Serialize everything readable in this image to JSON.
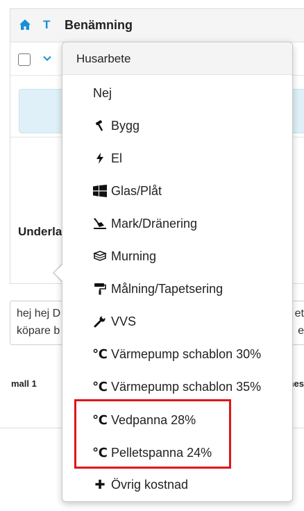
{
  "table": {
    "type_col": "T",
    "name_col": "Benämning",
    "section_label": "Underla"
  },
  "note": {
    "line1": "hej hej D",
    "line2": "köpare b",
    "line1_right": "et",
    "line2_right": "e"
  },
  "footer": {
    "left_label": "mall 1",
    "right_label": "nes"
  },
  "menu": {
    "header": "Husarbete",
    "items": [
      {
        "label": "Nej",
        "icon": "none"
      },
      {
        "label": "Bygg",
        "icon": "hammer-icon"
      },
      {
        "label": "El",
        "icon": "bolt-icon"
      },
      {
        "label": "Glas/Plåt",
        "icon": "windows-icon"
      },
      {
        "label": "Mark/Dränering",
        "icon": "shovel-icon"
      },
      {
        "label": "Murning",
        "icon": "bricks-icon"
      },
      {
        "label": "Målning/Tapetsering",
        "icon": "paint-roller-icon"
      },
      {
        "label": "VVS",
        "icon": "wrench-icon"
      },
      {
        "label": "Värmepump schablon 30%",
        "icon": "celsius-icon",
        "symbol": "℃"
      },
      {
        "label": "Värmepump schablon 35%",
        "icon": "celsius-icon",
        "symbol": "℃"
      },
      {
        "label": "Vedpanna 28%",
        "icon": "celsius-icon",
        "symbol": "℃"
      },
      {
        "label": "Pelletspanna 24%",
        "icon": "celsius-icon",
        "symbol": "℃"
      },
      {
        "label": "Övrig kostnad",
        "icon": "plus-icon",
        "symbol": "✚"
      }
    ]
  },
  "colors": {
    "accent": "#1a8fd6",
    "highlight": "#e0141a"
  }
}
